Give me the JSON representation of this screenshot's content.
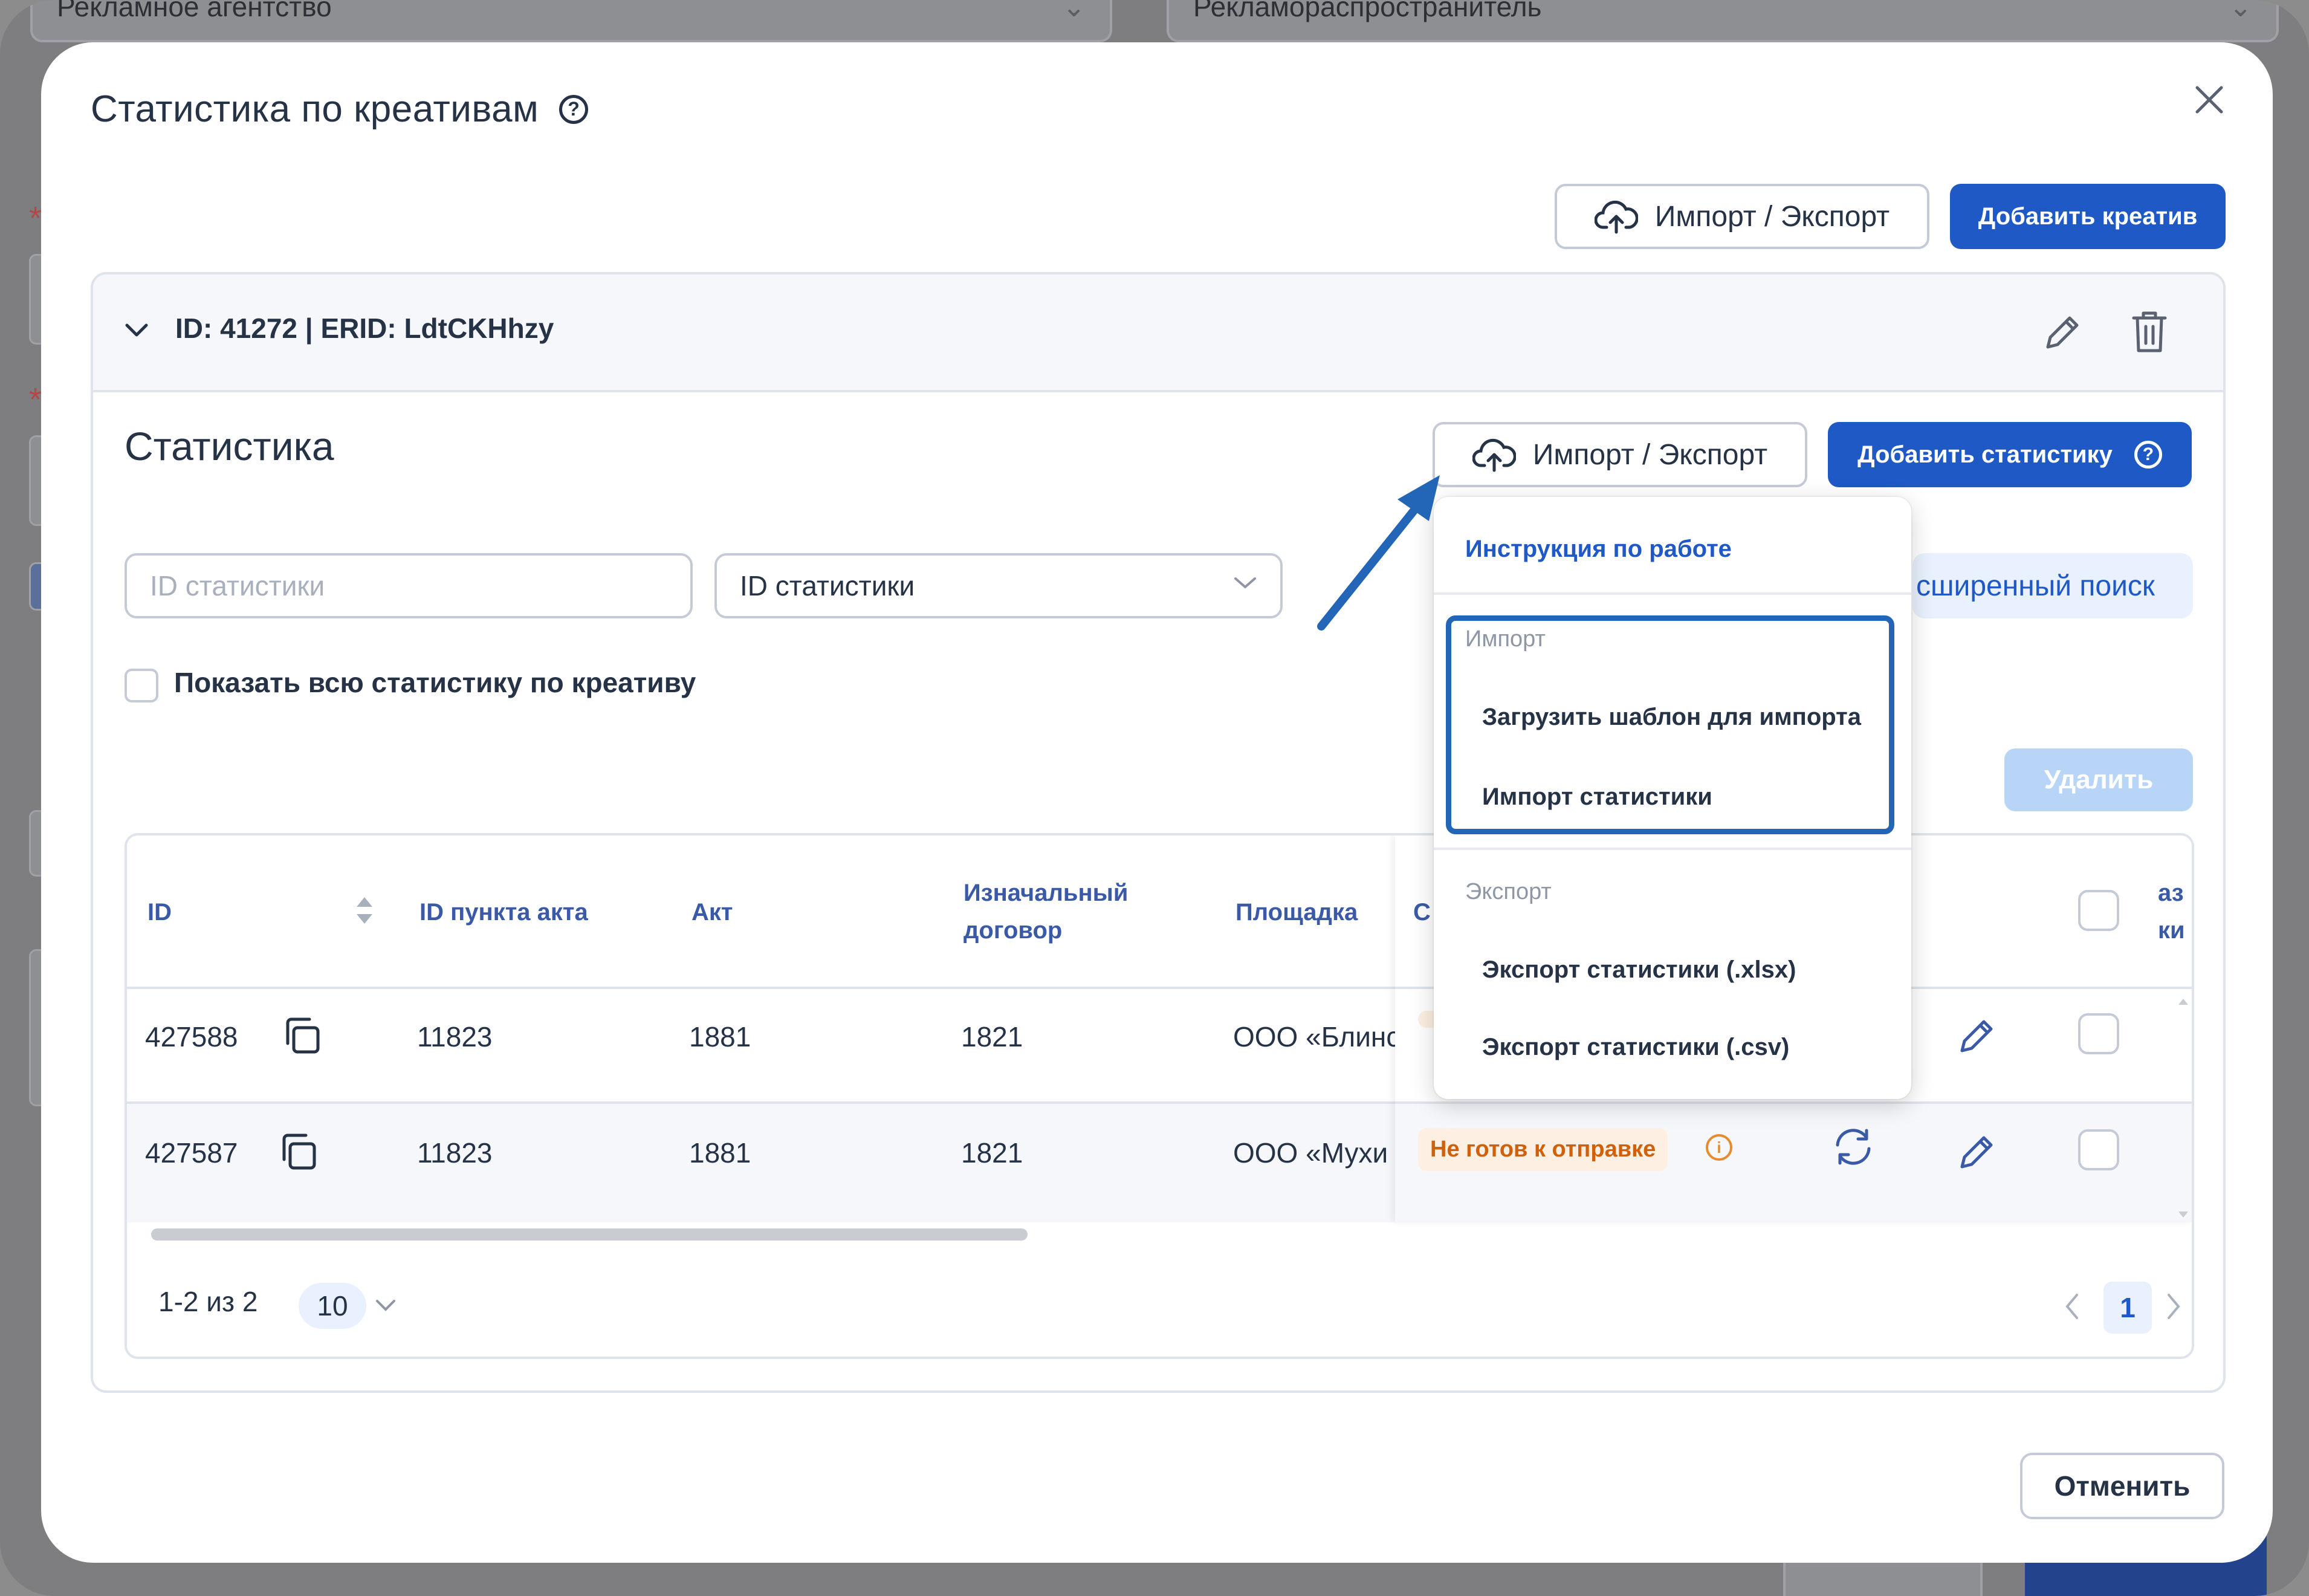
{
  "background": {
    "agency_label": "Рекламное агентство",
    "distributor_label": "Рекламораспространитель"
  },
  "modal": {
    "title": "Статистика по креативам",
    "import_export_label": "Импорт / Экспорт",
    "add_creative_label": "Добавить креатив",
    "cancel_label": "Отменить"
  },
  "creative": {
    "header": "ID: 41272 | ERID: LdtCKHhzy"
  },
  "statistics": {
    "title": "Статистика",
    "import_export_label": "Импорт / Экспорт",
    "add_stat_label": "Добавить статистику",
    "search_placeholder": "ID статистики",
    "search_field_value": "ID статистики",
    "advanced_search_label": "сширенный поиск",
    "show_all_label": "Показать всю статистику по креативу",
    "delete_label": "Удалить"
  },
  "table": {
    "columns": [
      "ID",
      "ID пункта акта",
      "Акт",
      "Изначальный",
      "договор",
      "Площадка",
      "С",
      "аз",
      "ки"
    ],
    "rows": [
      {
        "id": "427588",
        "act_item": "11823",
        "act": "1881",
        "contract": "1821",
        "platform": "ООО «Блинс",
        "status": ""
      },
      {
        "id": "427587",
        "act_item": "11823",
        "act": "1881",
        "contract": "1821",
        "platform": "ООО «Мухи",
        "status": "Не готов к отправке"
      }
    ]
  },
  "pagination": {
    "range": "1-2 из 2",
    "page_size": "10",
    "current_page": "1"
  },
  "menu": {
    "instruction": "Инструкция по работе",
    "import_group": "Импорт",
    "import_items": [
      "Загрузить шаблон для импорта",
      "Импорт статистики"
    ],
    "export_group": "Экспорт",
    "export_items": [
      "Экспорт статистики (.xlsx)",
      "Экспорт статистики (.csv)"
    ]
  },
  "colors": {
    "primary": "#1f59c6",
    "annotation": "#2366b7",
    "status_warning": "#d0610c"
  }
}
